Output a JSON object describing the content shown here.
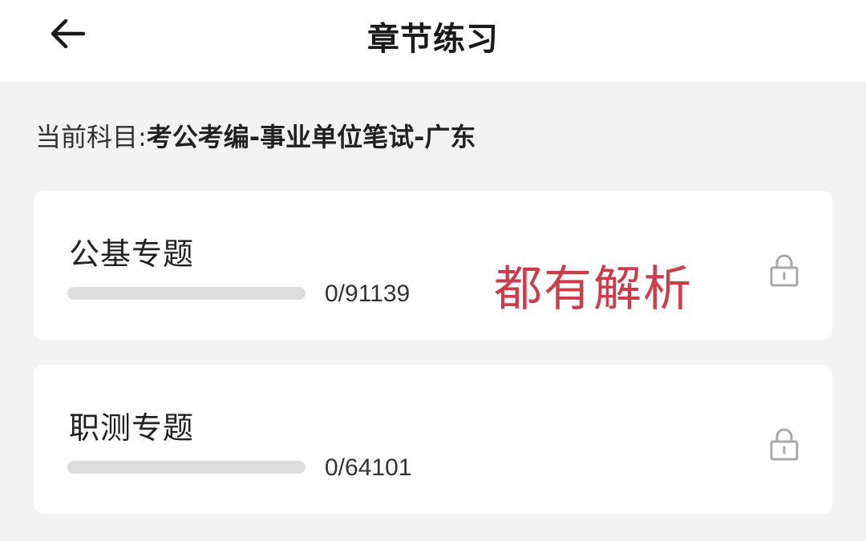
{
  "header": {
    "back_icon": "arrow-left-icon",
    "title": "章节练习"
  },
  "subject": {
    "label": "当前科目:",
    "value": "考公考编-事业单位笔试-广东"
  },
  "chapters": [
    {
      "title": "公基专题",
      "progress_text": "0/91139",
      "progress_fraction": 0,
      "lock_icon": "lock-icon"
    },
    {
      "title": "职测专题",
      "progress_text": "0/64101",
      "progress_fraction": 0,
      "lock_icon": "lock-icon"
    }
  ],
  "annotation": {
    "text": "都有解析",
    "color": "#cc3d4b"
  },
  "colors": {
    "background": "#f3f3f3",
    "card": "#ffffff",
    "progress_track": "#dcdcdc"
  }
}
